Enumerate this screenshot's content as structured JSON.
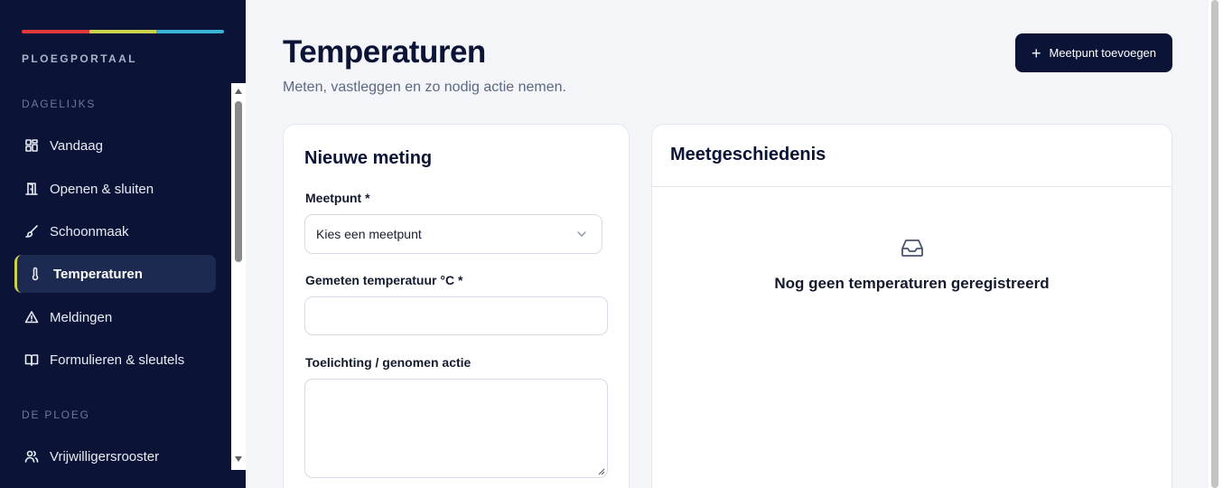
{
  "brand": {
    "name": "PLOEGPORTAAL",
    "bar_colors": [
      "#e03b3b",
      "#c9d24a",
      "#3ab3d9"
    ]
  },
  "sidebar": {
    "sections": [
      {
        "label": "DAGELIJKS",
        "items": [
          {
            "label": "Vandaag",
            "icon": "dashboard-icon"
          },
          {
            "label": "Openen & sluiten",
            "icon": "door-icon"
          },
          {
            "label": "Schoonmaak",
            "icon": "brush-icon"
          },
          {
            "label": "Temperaturen",
            "icon": "thermometer-icon",
            "active": true
          },
          {
            "label": "Meldingen",
            "icon": "warning-icon"
          },
          {
            "label": "Formulieren & sleutels",
            "icon": "book-icon"
          }
        ]
      },
      {
        "label": "DE PLOEG",
        "items": [
          {
            "label": "Vrijwilligersrooster",
            "icon": "users-icon"
          }
        ]
      }
    ]
  },
  "header": {
    "title": "Temperaturen",
    "subtitle": "Meten, vastleggen en zo nodig actie nemen.",
    "add_button_label": "Meetpunt toevoegen"
  },
  "form": {
    "title": "Nieuwe meting",
    "meetpunt_label": "Meetpunt *",
    "meetpunt_value": "Kies een meetpunt",
    "temperature_label": "Gemeten temperatuur °C *",
    "temperature_value": "",
    "note_label": "Toelichting / genomen actie",
    "note_value": ""
  },
  "history": {
    "title": "Meetgeschiedenis",
    "empty_text": "Nog geen temperaturen geregistreerd",
    "empty_icon": "inbox-icon"
  },
  "colors": {
    "sidebar_bg": "#0b1437",
    "accent": "#c9d24a",
    "primary_button": "#0b1437"
  }
}
